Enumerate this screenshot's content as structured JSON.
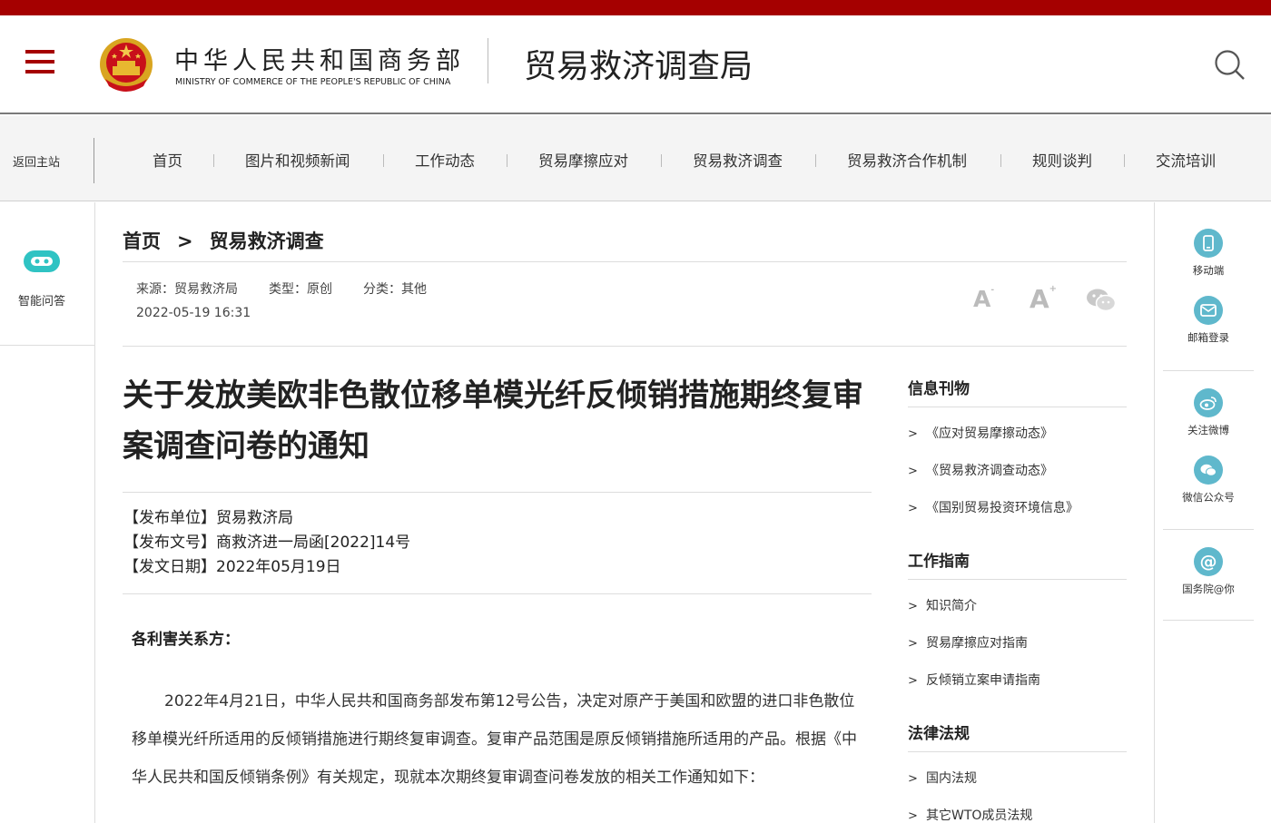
{
  "header": {
    "ministry_cn": "中华人民共和国商务部",
    "ministry_en": "MINISTRY OF COMMERCE OF THE PEOPLE'S REPUBLIC OF CHINA",
    "bureau": "贸易救济调查局"
  },
  "nav": {
    "back": "返回主站",
    "items": [
      "首页",
      "图片和视频新闻",
      "工作动态",
      "贸易摩擦应对",
      "贸易救济调查",
      "贸易救济合作机制",
      "规则谈判",
      "交流培训"
    ]
  },
  "left_panel": {
    "bot_label": "智能问答"
  },
  "right_side": {
    "items": [
      "移动端",
      "邮箱登录",
      "关注微博",
      "微信公众号",
      "国务院@你"
    ]
  },
  "breadcrumb": {
    "home": "首页",
    "sep": ">",
    "current": "贸易救济调查"
  },
  "meta": {
    "source": "来源：贸易救济局",
    "type": "类型：原创",
    "category": "分类：其他",
    "date": "2022-05-19 16:31"
  },
  "article": {
    "title": "关于发放美欧非色散位移单模光纤反倾销措施期终复审案调查问卷的通知",
    "issuer": "【发布单位】贸易救济局",
    "doc_no": "【发布文号】商救济进一局函[2022]14号",
    "date": "【发文日期】2022年05月19日",
    "greeting": "各利害关系方：",
    "paragraph": "2022年4月21日，中华人民共和国商务部发布第12号公告，决定对原产于美国和欧盟的进口非色散位移单模光纤所适用的反倾销措施进行期终复审调查。复审产品范围是原反倾销措施所适用的产品。根据《中华人民共和国反倾销条例》有关规定，现就本次期终复审调查问卷发放的相关工作通知如下："
  },
  "sidebar": {
    "sections": [
      {
        "title": "信息刊物",
        "links": [
          "《应对贸易摩擦动态》",
          "《贸易救济调查动态》",
          "《国别贸易投资环境信息》"
        ]
      },
      {
        "title": "工作指南",
        "links": [
          "知识简介",
          "贸易摩擦应对指南",
          "反倾销立案申请指南"
        ]
      },
      {
        "title": "法律法规",
        "links": [
          "国内法规",
          "其它WTO成员法规"
        ]
      }
    ],
    "chevron": ">"
  },
  "colors": {
    "brand_red": "#a50000",
    "icon_teal": "#5fb8cc",
    "bot_teal": "#2fc3c3"
  }
}
